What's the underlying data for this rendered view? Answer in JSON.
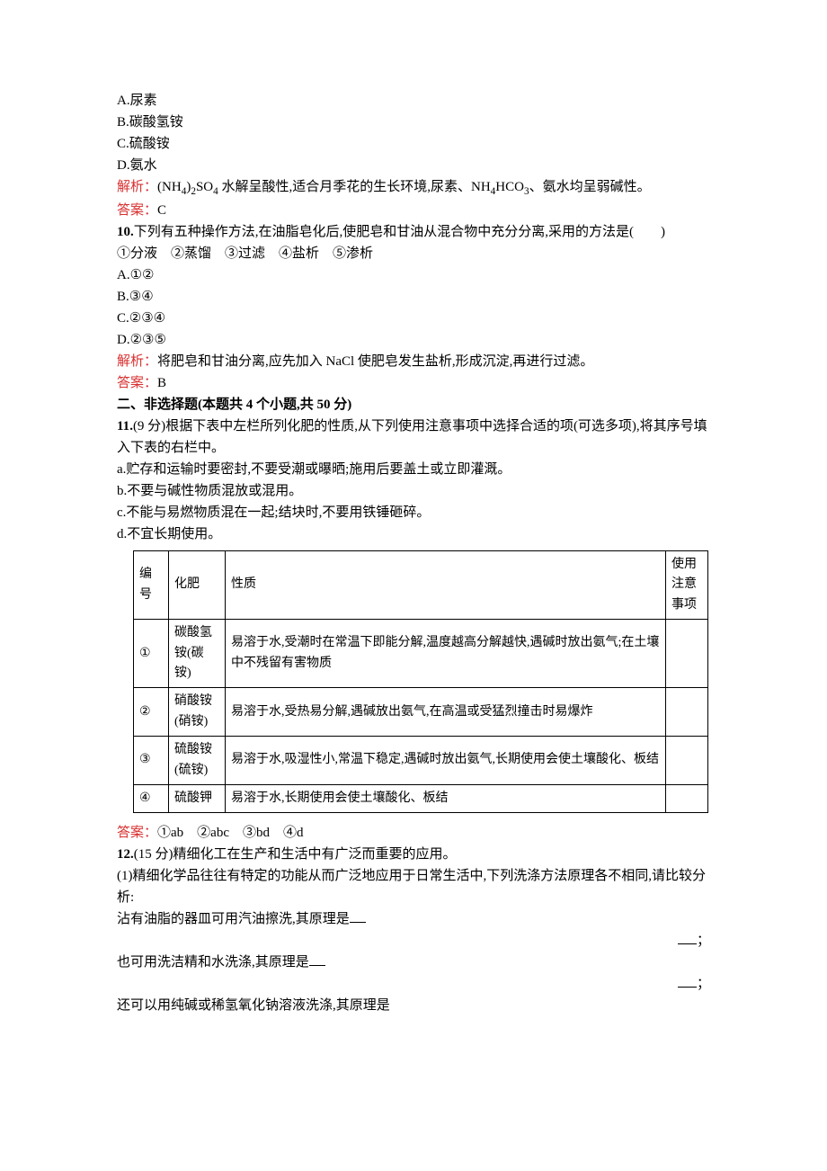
{
  "q_options": {
    "A": "A.尿素",
    "B": "B.碳酸氢铵",
    "C": "C.硫酸铵",
    "D": "D.氨水"
  },
  "analysis_label": "解析：",
  "analysis9_pre": "(NH",
  "analysis9_sub1": "4",
  "analysis9_mid1": ")",
  "analysis9_sub2": "2",
  "analysis9_mid2": "SO",
  "analysis9_sub3": "4",
  "analysis9_mid3": " 水解呈酸性,适合月季花的生长环境,尿素、NH",
  "analysis9_sub4": "4",
  "analysis9_mid4": "HCO",
  "analysis9_sub5": "3",
  "analysis9_end": "、氨水均呈弱碱性。",
  "answer_label": "答案：",
  "answer9": "C",
  "q10_stem": "下列有五种操作方法,在油脂皂化后,使肥皂和甘油从混合物中充分分离,采用的方法是(　　)",
  "q10_num": "10",
  "q10_methods": "①分液　②蒸馏　③过滤　④盐析　⑤渗析",
  "q10_opts": {
    "A": "A.①②",
    "B": "B.③④",
    "C": "C.②③④",
    "D": "D.②③⑤"
  },
  "analysis10": "将肥皂和甘油分离,应先加入 NaCl 使肥皂发生盐析,形成沉淀,再进行过滤。",
  "answer10": "B",
  "section2": "二、非选择题(本题共 4 个小题,共 50 分)",
  "q11_num": "11",
  "q11_points": "(9 分)",
  "q11_stem": "根据下表中左栏所列化肥的性质,从下列使用注意事项中选择合适的项(可选多项),将其序号填入下表的右栏中。",
  "q11_a": "a.贮存和运输时要密封,不要受潮或曝晒;施用后要盖土或立即灌溉。",
  "q11_b": "b.不要与碱性物质混放或混用。",
  "q11_c": "c.不能与易燃物质混在一起;结块时,不要用铁锤砸碎。",
  "q11_d": "d.不宜长期使用。",
  "table": {
    "head": {
      "num": "编号",
      "name": "化肥",
      "prop": "性质",
      "note": "使用注意事项"
    },
    "rows": [
      {
        "num": "①",
        "name": "碳酸氢铵(碳铵)",
        "prop": "易溶于水,受潮时在常温下即能分解,温度越高分解越快,遇碱时放出氨气;在土壤中不残留有害物质",
        "note": ""
      },
      {
        "num": "②",
        "name": "硝酸铵(硝铵)",
        "prop": "易溶于水,受热易分解,遇碱放出氨气,在高温或受猛烈撞击时易爆炸",
        "note": ""
      },
      {
        "num": "③",
        "name": "硫酸铵(硫铵)",
        "prop": "易溶于水,吸湿性小,常温下稳定,遇碱时放出氨气,长期使用会使土壤酸化、板结",
        "note": ""
      },
      {
        "num": "④",
        "name": "硫酸钾",
        "prop": "易溶于水,长期使用会使土壤酸化、板结",
        "note": ""
      }
    ]
  },
  "answer11": "①ab　②abc　③bd　④d",
  "q12_num": "12",
  "q12_points": "(15 分)",
  "q12_stem": "精细化工在生产和生活中有广泛而重要的应用。",
  "q12_p1": "(1)精细化学品往往有特定的功能从而广泛地应用于日常生活中,下列洗涤方法原理各不相同,请比较分析:",
  "q12_line1": "沾有油脂的器皿可用汽油擦洗,其原理是",
  "q12_line2": "也可用洗洁精和水洗涤,其原理是",
  "q12_line3": "还可以用纯碱或稀氢氧化钠溶液洗涤,其原理是",
  "semicolon": "；"
}
